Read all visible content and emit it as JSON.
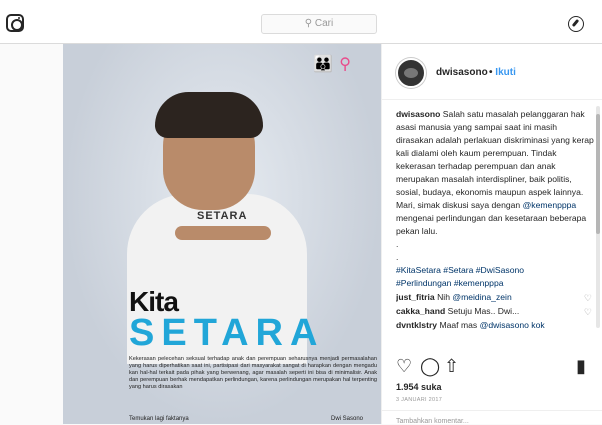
{
  "search": {
    "placeholder": "Cari",
    "icon": "search-icon"
  },
  "post_image": {
    "shirt_text": "SETARA",
    "title_line1": "Kita",
    "title_line2": "SETARA",
    "body": "Kekerasan pelecehan seksual terhadap anak dan perempuan seharusnya menjadi permasalahan yang harus diperhatikan saat ini, partisipasi dari masyarakat sangat di harapkan dengan mengadu kan hal-hal terkait pada pihak yang berwenang, agar masalah seperti ini bisa di minimalisir. Anak dan perempuan berhak mendapatkan perlindungan, karena perlindungan merupakan hal terpenting yang harus dirasakan",
    "footer_left": "Temukan lagi faktanya",
    "footer_right": "Dwi Sasono"
  },
  "header": {
    "username": "dwisasono",
    "separator": "•",
    "follow_label": "Ikuti"
  },
  "caption": {
    "author": "dwisasono",
    "text": " Salah satu masalah pelanggaran hak asasi manusia yang sampai saat ini masih dirasakan adalah perlakuan diskriminasi yang kerap kali dialami oleh kaum perempuan. Tindak kekerasan terhadap perempuan dan anak merupakan masalah interdispliner, baik politis, sosial, budaya, ekonomis maupun aspek lainnya. Mari, simak diskusi saya dengan ",
    "mention": "@kemenpppa",
    "text2": " mengenai perlindungan dan kesetaraan beberapa pekan lalu.",
    "dots": [
      ".",
      "."
    ],
    "hashtags_line1": "#KitaSetara #Setara #DwiSasono",
    "hashtags_line2": "#Perlindungan #kemenpppa"
  },
  "comments": [
    {
      "user": "just_fitria",
      "text": " Nih ",
      "mention": "@meidina_zein"
    },
    {
      "user": "cakka_hand",
      "text": " Setuju Mas.. Dwi...",
      "mention": ""
    },
    {
      "user": "dvntklstry",
      "text": " Maaf mas ",
      "mention": "@dwisasono kok"
    }
  ],
  "likes": "1.954 suka",
  "date": "3 JANUARI 2017",
  "add_comment_placeholder": "Tambahkan komentar..."
}
